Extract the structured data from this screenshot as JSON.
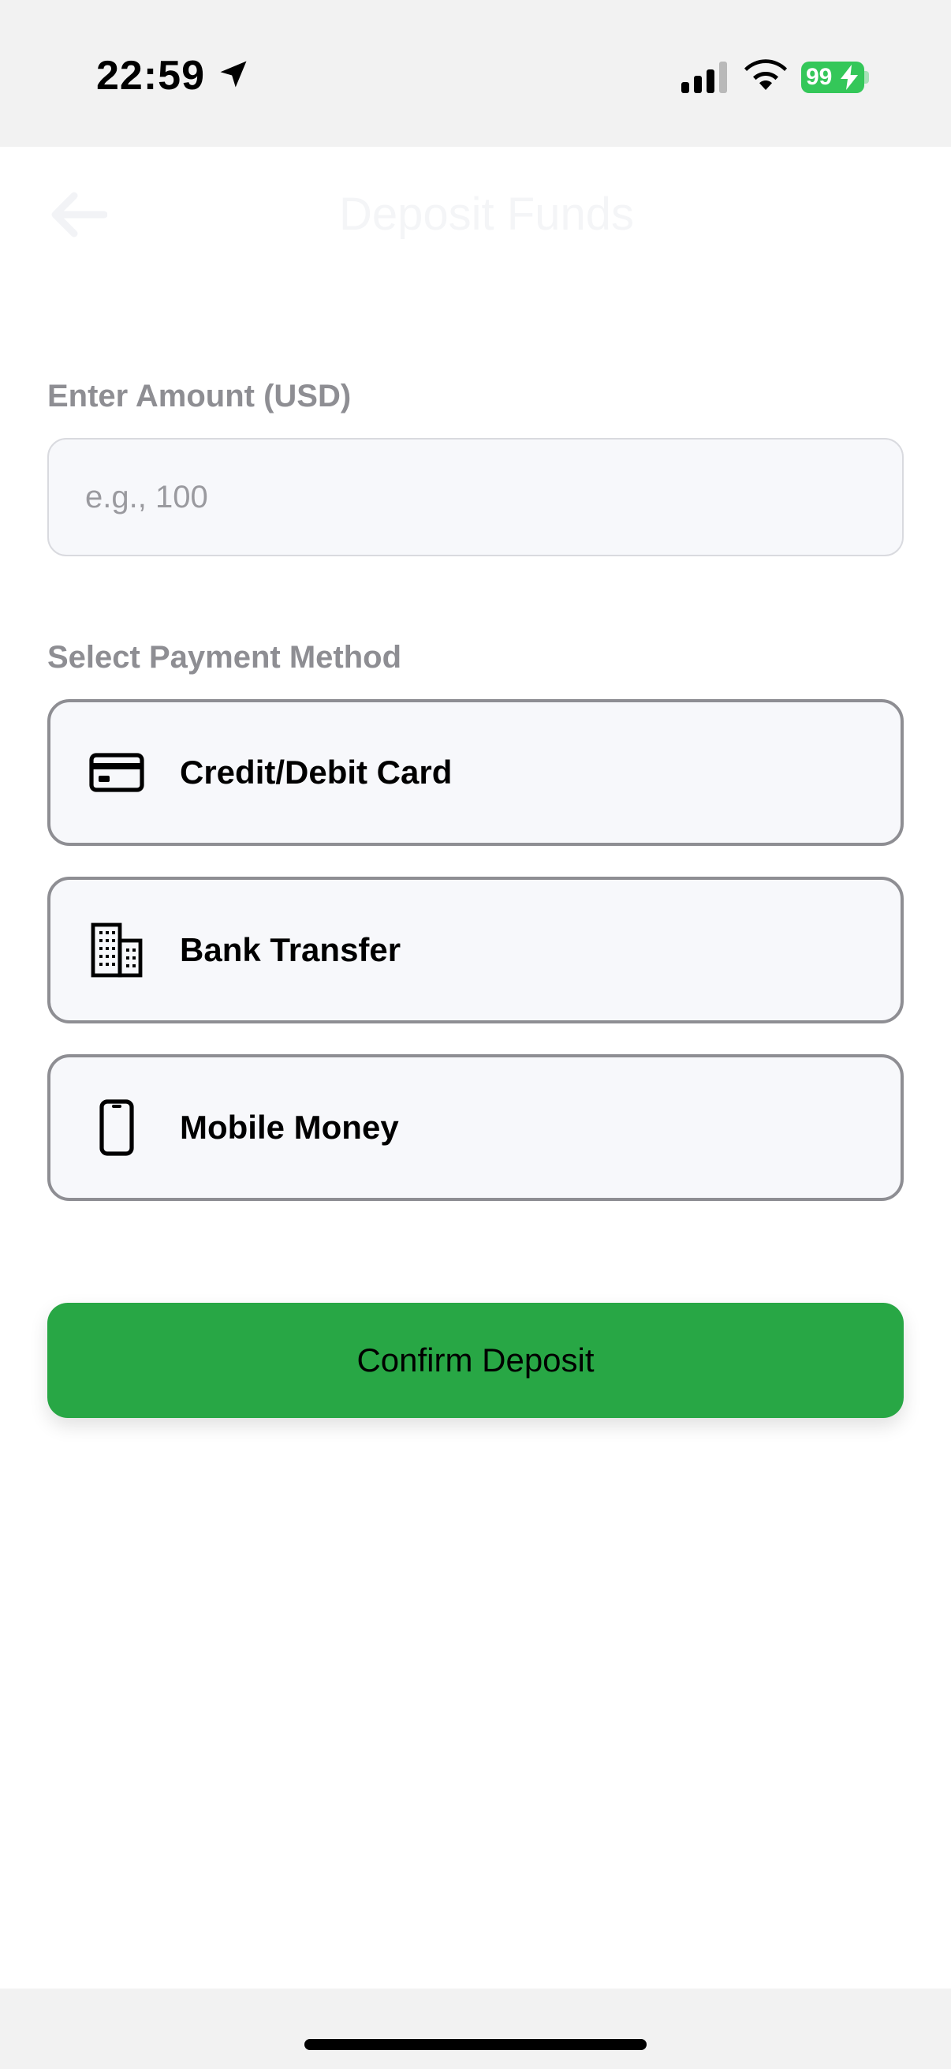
{
  "status_bar": {
    "time": "22:59",
    "battery_level": "99",
    "icons": [
      "location-arrow-icon",
      "cellular-signal-icon",
      "wifi-icon",
      "battery-charging-icon"
    ]
  },
  "nav": {
    "title": "Deposit Funds",
    "back_icon": "arrow-left-icon"
  },
  "amount": {
    "label": "Enter Amount (USD)",
    "placeholder": "e.g., 100",
    "value": ""
  },
  "payment": {
    "label": "Select Payment Method",
    "methods": [
      {
        "label": "Credit/Debit Card",
        "icon": "credit-card-icon"
      },
      {
        "label": "Bank Transfer",
        "icon": "building-icon"
      },
      {
        "label": "Mobile Money",
        "icon": "smartphone-icon"
      }
    ]
  },
  "confirm": {
    "label": "Confirm Deposit"
  },
  "colors": {
    "accent_green": "#28a745",
    "battery_green": "#34c759",
    "label_gray": "#8e8e93",
    "card_bg": "#f7f8fb"
  }
}
